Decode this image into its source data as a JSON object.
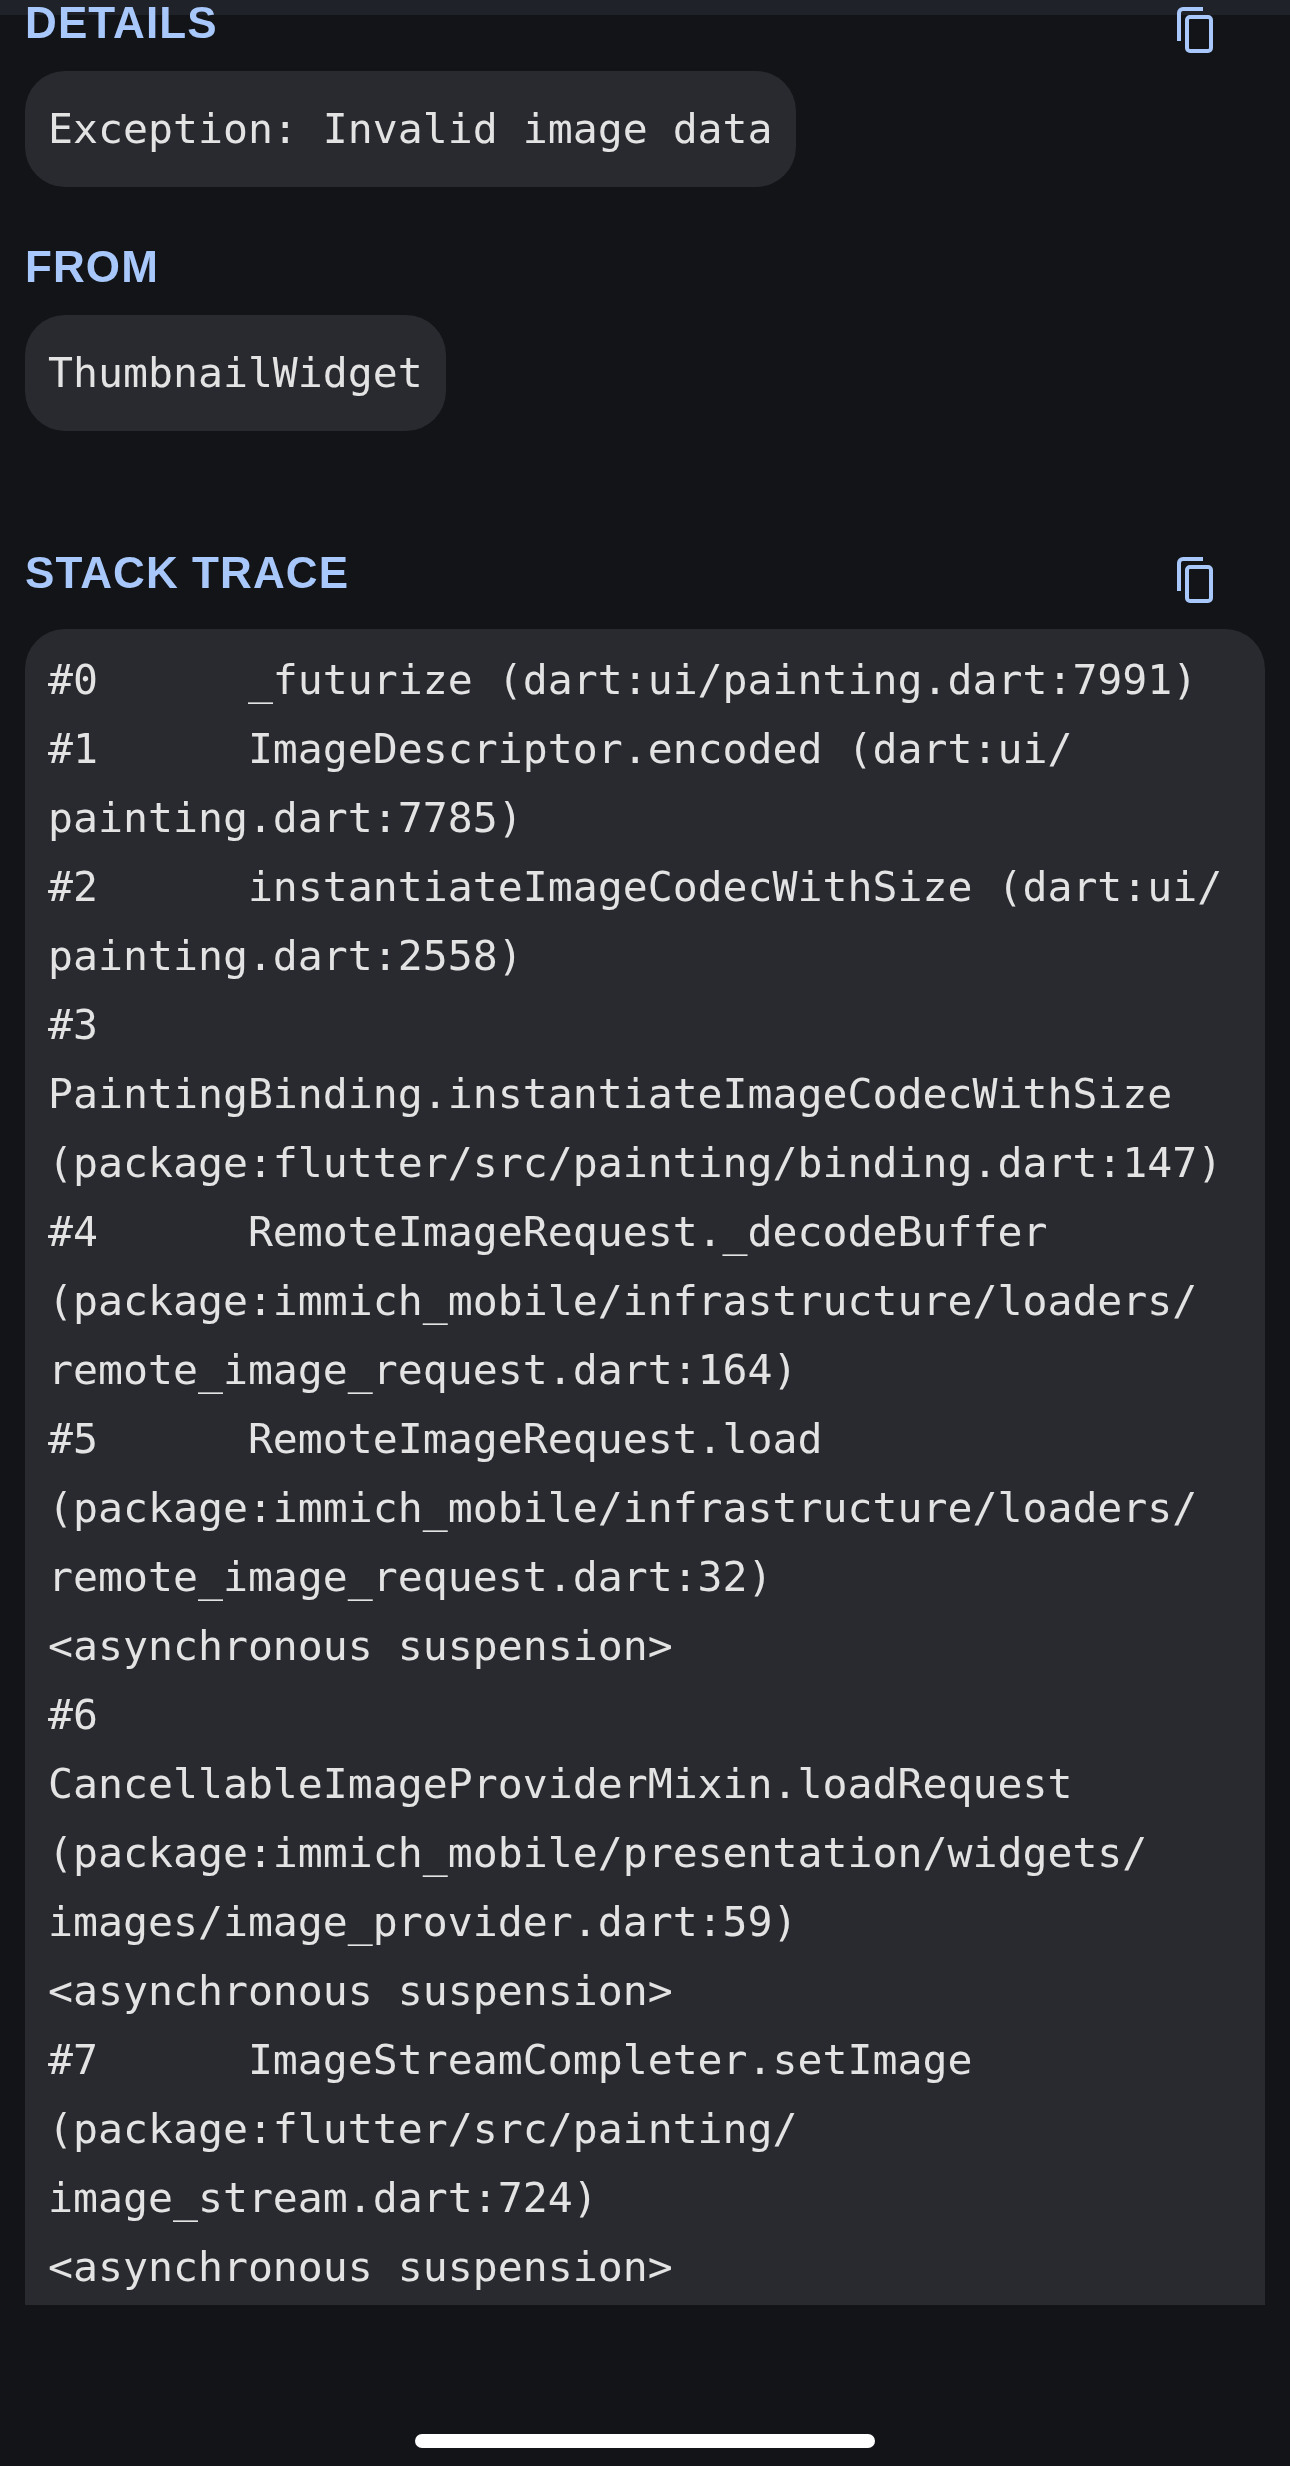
{
  "sections": [
    {
      "heading": "DETAILS",
      "copy_button": true,
      "kind": "pill",
      "text": "Exception: Invalid image data"
    },
    {
      "heading": "FROM",
      "copy_button": false,
      "kind": "pill",
      "text": "ThumbnailWidget"
    },
    {
      "heading": "STACK TRACE",
      "copy_button": true,
      "kind": "trace",
      "lines": [
        "#0      _futurize (dart:ui/painting.dart:7991)",
        "#1      ImageDescriptor.encoded (dart:ui/",
        "painting.dart:7785)",
        "#2      instantiateImageCodecWithSize (dart:ui/",
        "painting.dart:2558)",
        "#3",
        "PaintingBinding.instantiateImageCodecWithSize",
        "(package:flutter/src/painting/binding.dart:147)",
        "#4      RemoteImageRequest._decodeBuffer",
        "(package:immich_mobile/infrastructure/loaders/",
        "remote_image_request.dart:164)",
        "#5      RemoteImageRequest.load",
        "(package:immich_mobile/infrastructure/loaders/",
        "remote_image_request.dart:32)",
        "<asynchronous suspension>",
        "#6",
        "CancellableImageProviderMixin.loadRequest",
        "(package:immich_mobile/presentation/widgets/",
        "images/image_provider.dart:59)",
        "<asynchronous suspension>",
        "#7      ImageStreamCompleter.setImage",
        "(package:flutter/src/painting/",
        "image_stream.dart:724)",
        "<asynchronous suspension>"
      ]
    }
  ]
}
